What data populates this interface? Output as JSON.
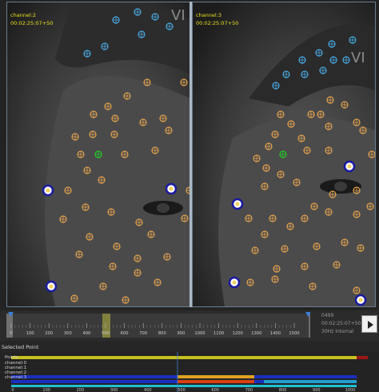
{
  "views": [
    {
      "channel": "channel:2",
      "timecode": "00:02:25:07+50"
    },
    {
      "channel": "channel:3",
      "timecode": "00:02:25:07+50"
    }
  ],
  "timeline": {
    "ticks": [
      "0",
      "100",
      "200",
      "300",
      "400",
      "500",
      "600",
      "700",
      "800",
      "900",
      "1000",
      "1100",
      "1200",
      "1300",
      "1400",
      "1500"
    ],
    "frame": "0499",
    "timecode": "00:02:25:07+50",
    "rate": "30Hz Internal"
  },
  "selected_point": {
    "title": "Selected Point",
    "tracks": [
      "Points",
      "channel:0",
      "channel:1",
      "channel:2",
      "channel:3"
    ],
    "ticks": [
      "0",
      "100",
      "200",
      "300",
      "400",
      "500",
      "600",
      "700",
      "800",
      "900",
      "1000"
    ]
  },
  "colors": {
    "marker": "#e0a050",
    "blue_marker": "#4aa8e0",
    "selected": "#22cc22",
    "accent": "#e8e020"
  }
}
